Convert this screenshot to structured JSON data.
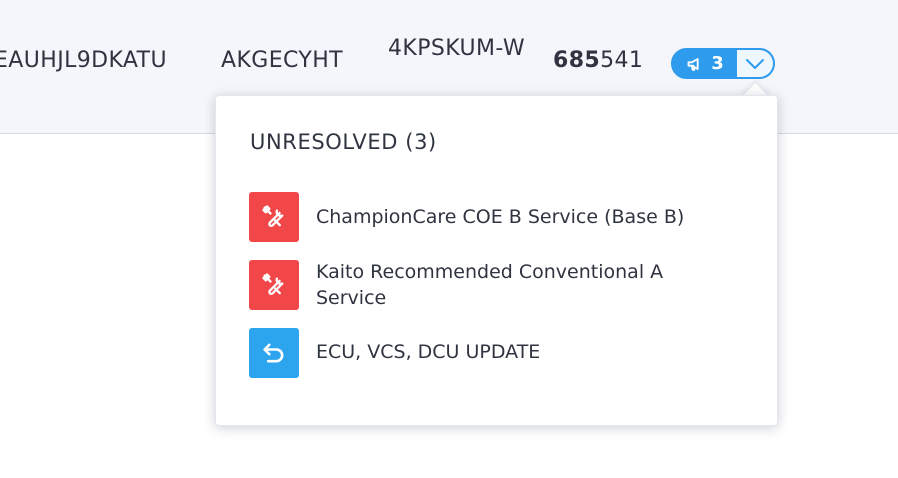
{
  "header": {
    "vin": "EAUHJL9DKATU",
    "code": "AKGECYHT",
    "plate": "4KPSKUM-W",
    "odometer_bold": "685",
    "odometer_rest": "541",
    "campaign_count": "3"
  },
  "dropdown": {
    "title": "UNRESOLVED",
    "title_count": "(3)",
    "items": [
      {
        "label": "ChampionCare COE B Service (Base B)",
        "icon": "tools-icon",
        "color": "#f24749"
      },
      {
        "label": "Kaito Recommended Conventional A Service",
        "icon": "tools-icon",
        "color": "#f24749"
      },
      {
        "label": "ECU, VCS, DCU UPDATE",
        "icon": "undo-arrow-icon",
        "color": "#2da4ee"
      }
    ]
  },
  "colors": {
    "accent": "#2f9bec",
    "danger": "#f24749",
    "info": "#2da4ee"
  }
}
